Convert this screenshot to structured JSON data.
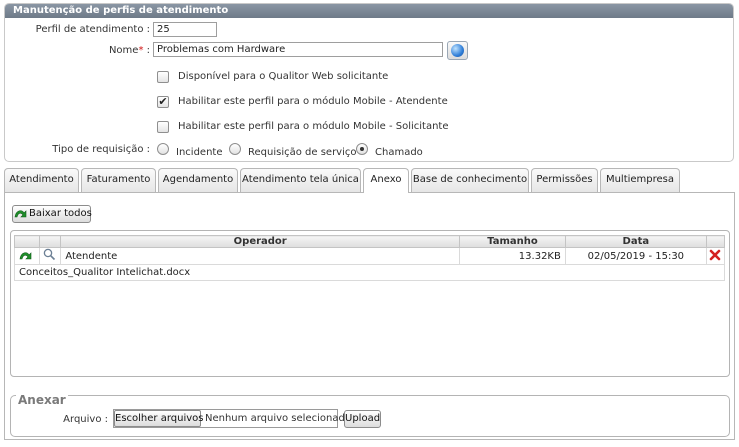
{
  "panel": {
    "title": "Manutenção de perfis de atendimento",
    "perfil_label": "Perfil de atendimento :",
    "perfil_value": "25",
    "nome_label": "Nome",
    "required_mark": "*",
    "nome_colon": ":",
    "nome_value": "Problemas com Hardware",
    "checkboxes": [
      {
        "label": "Disponível para o Qualitor Web solicitante",
        "checked": false
      },
      {
        "label": "Habilitar este perfil para o módulo Mobile - Atendente",
        "checked": true
      },
      {
        "label": "Habilitar este perfil para o módulo Mobile - Solicitante",
        "checked": false
      }
    ],
    "tipo_label": "Tipo de requisição :",
    "radios": [
      {
        "label": "Incidente",
        "selected": false
      },
      {
        "label": "Requisição de serviço",
        "selected": false
      },
      {
        "label": "Chamado",
        "selected": true
      }
    ]
  },
  "tabs": [
    {
      "label": "Atendimento"
    },
    {
      "label": "Faturamento"
    },
    {
      "label": "Agendamento"
    },
    {
      "label": "Atendimento tela única"
    },
    {
      "label": "Anexo"
    },
    {
      "label": "Base de conhecimento"
    },
    {
      "label": "Permissões"
    },
    {
      "label": "Multiempresa"
    }
  ],
  "active_tab": "Anexo",
  "anexo": {
    "download_all_label": "Baixar todos",
    "columns": [
      "Operador",
      "Tamanho",
      "Data"
    ],
    "rows": [
      {
        "operador": "Atendente",
        "tamanho": "13.32KB",
        "data": "02/05/2019 - 15:30",
        "filename": "Conceitos_Qualitor Intelichat.docx"
      }
    ]
  },
  "anexar": {
    "title": "Anexar",
    "arquivo_label": "Arquivo :",
    "choose_label": "Escolher arquivos",
    "no_file_label": "Nenhum arquivo selecionado",
    "upload_label": "Upload"
  },
  "colors": {
    "header_bar": "#7c8896",
    "link": "#2a4fa0",
    "required": "#d01414",
    "download_icon": "#1f8f2a",
    "delete_icon": "#d42020"
  },
  "icons": [
    "globe-icon",
    "download-arrow-icon",
    "magnifier-icon",
    "delete-x-icon"
  ]
}
